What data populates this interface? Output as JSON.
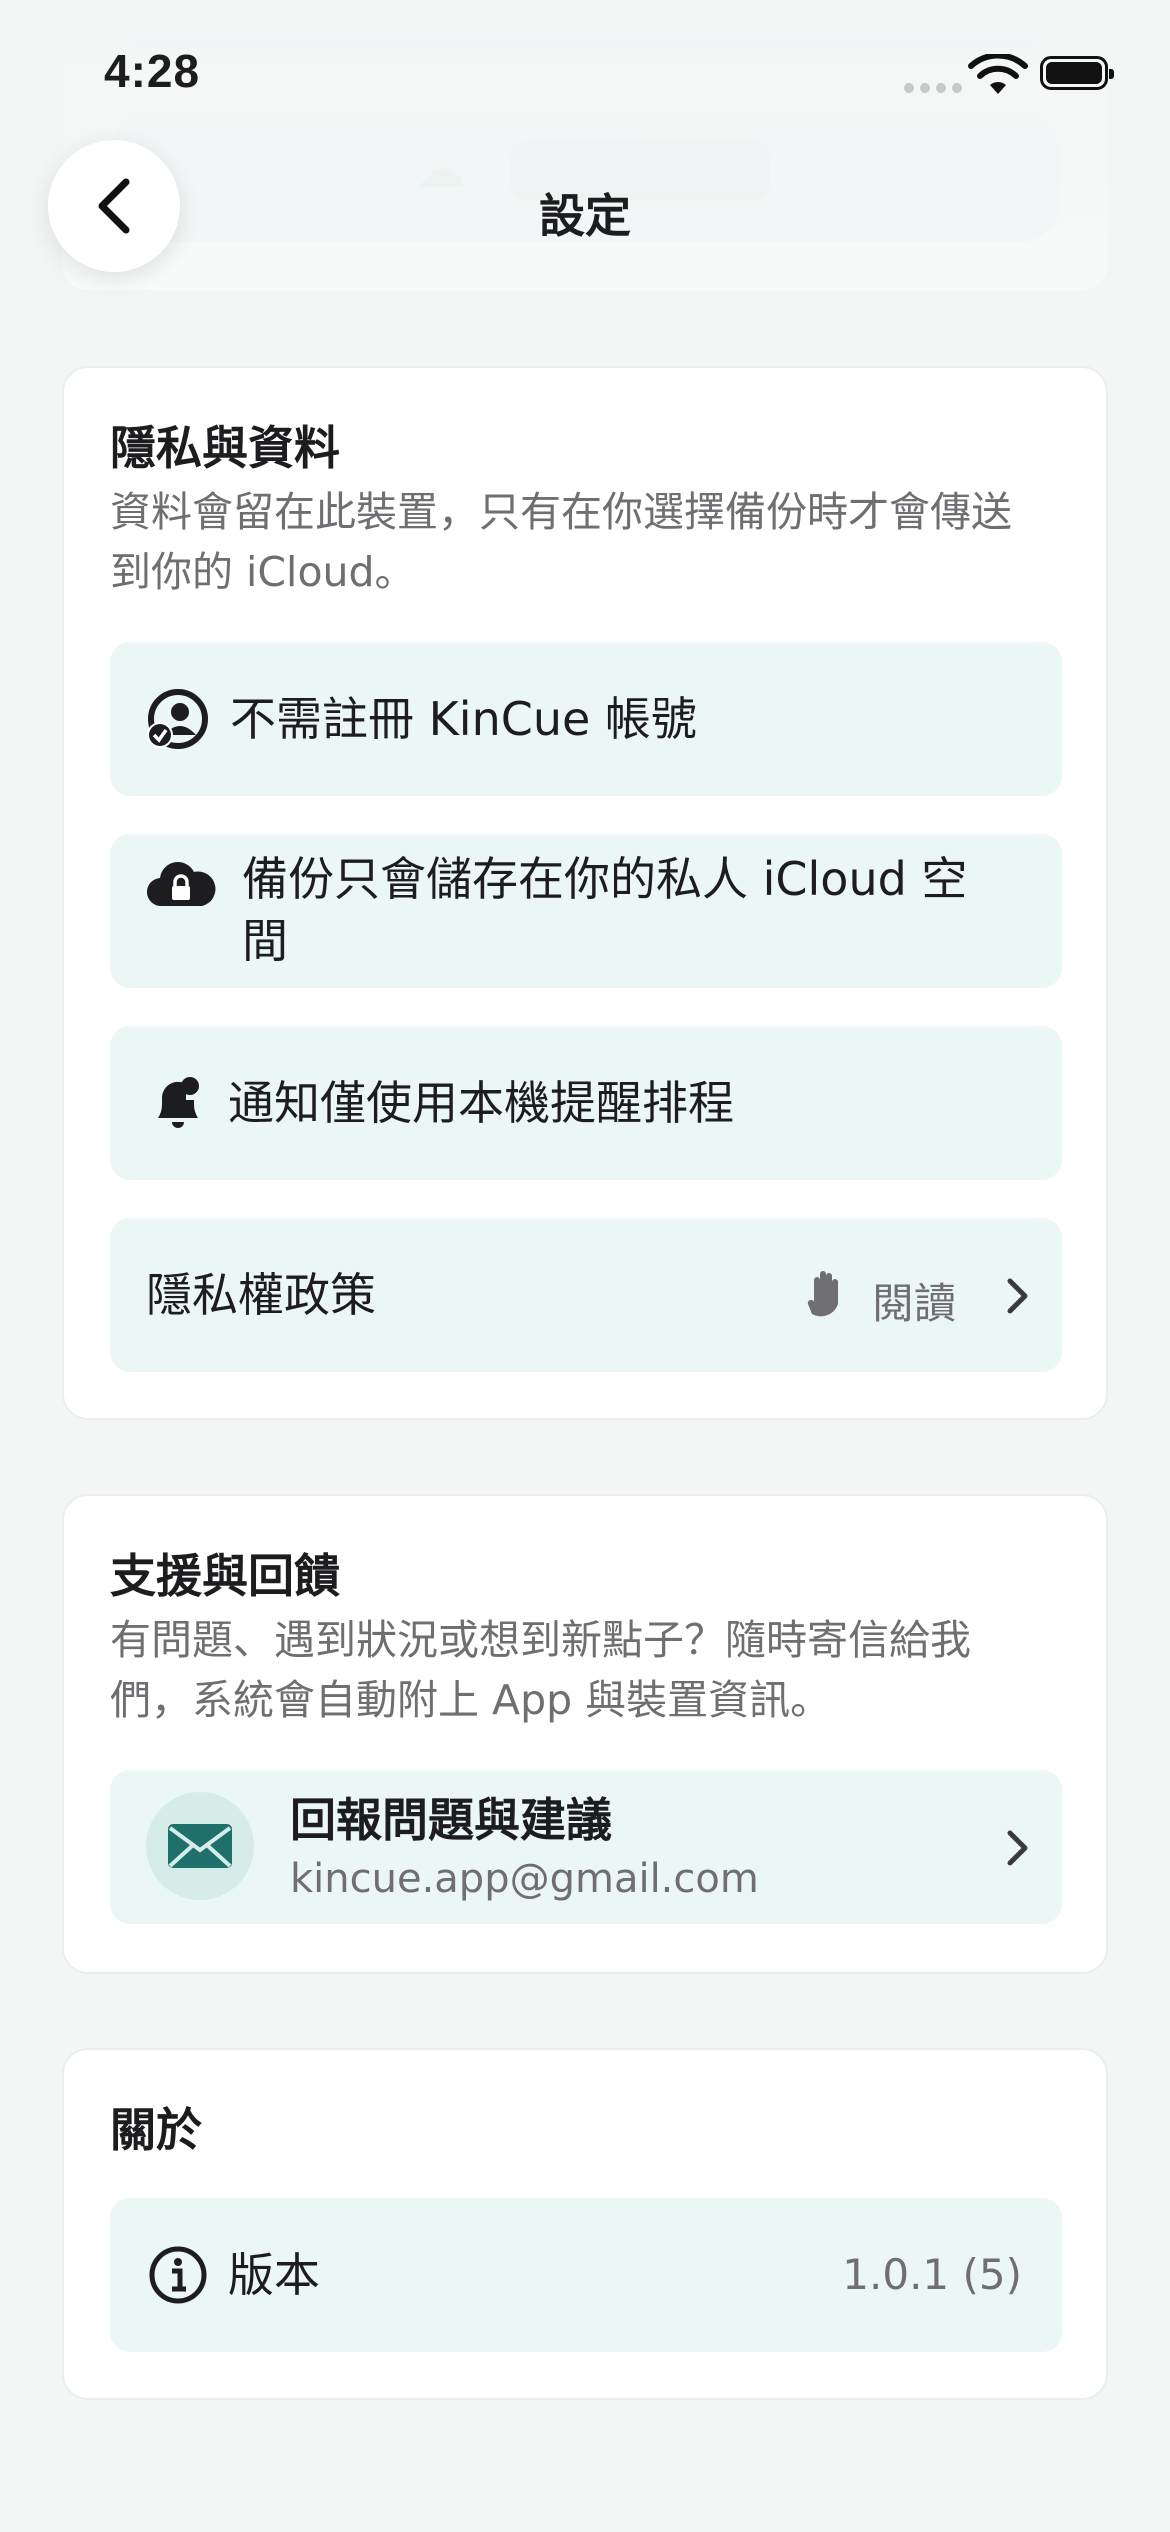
{
  "status_bar": {
    "time": "4:28"
  },
  "header": {
    "title": "設定"
  },
  "privacy": {
    "title": "隱私與資料",
    "description": "資料會留在此裝置，只有在你選擇備份時才會傳送到你的 iCloud。",
    "items": [
      {
        "icon": "person-check-icon",
        "label": "不需註冊 KinCue 帳號"
      },
      {
        "icon": "cloud-lock-icon",
        "label": "備份只會儲存在你的私人 iCloud 空間"
      },
      {
        "icon": "bell-badge-icon",
        "label": "通知僅使用本機提醒排程"
      }
    ],
    "policy": {
      "label": "隱私權政策",
      "action": "閱讀",
      "icon": "hand-raised-icon"
    }
  },
  "support": {
    "title": "支援與回饋",
    "description": "有問題、遇到狀況或想到新點子？隨時寄信給我們，系統會自動附上 App 與裝置資訊。",
    "feedback": {
      "title": "回報問題與建議",
      "email": "kincue.app@gmail.com",
      "icon": "envelope-icon"
    }
  },
  "about": {
    "title": "關於",
    "version_label": "版本",
    "version_value": "1.0.1 (5)",
    "icon": "info-circle-icon"
  },
  "colors": {
    "accent": "#1f6f6a",
    "row_bg": "#ebf7f4",
    "icon_circle": "#d6ece8"
  }
}
